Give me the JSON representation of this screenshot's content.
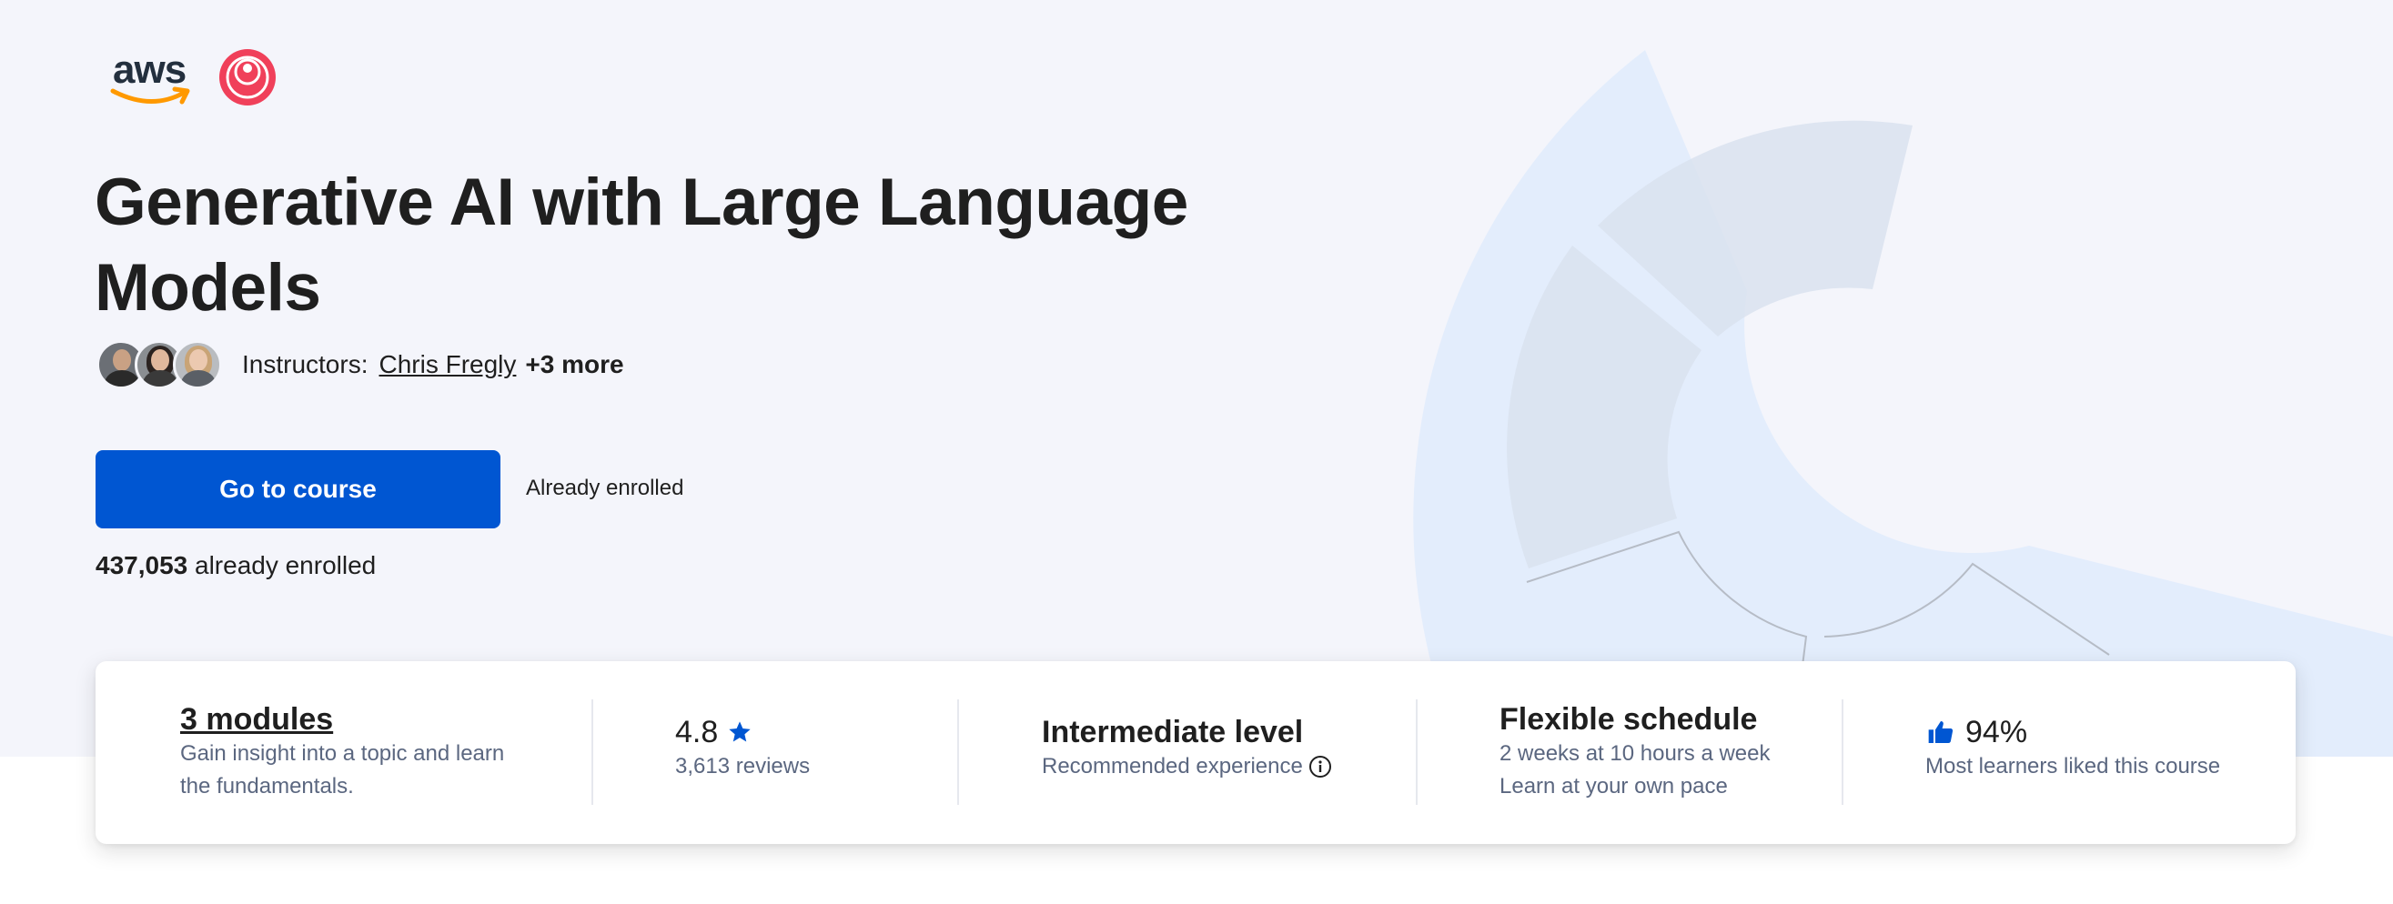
{
  "logos": {
    "aws_text": "aws",
    "aws_icon": "aws-logo",
    "partner_icon": "deeplearning-ai-logo"
  },
  "course": {
    "title": "Generative AI with Large Language Models"
  },
  "instructors": {
    "label": "Instructors:",
    "primary_name": "Chris Fregly",
    "more": "+3 more"
  },
  "cta": {
    "button_label": "Go to course",
    "status_note": "Already enrolled"
  },
  "enrollment": {
    "count": "437,053",
    "suffix": " already enrolled"
  },
  "stats": {
    "modules": {
      "title": "3 modules",
      "line1": "Gain insight into a topic and learn",
      "line2": "the fundamentals."
    },
    "rating": {
      "value": "4.8",
      "reviews": "3,613 reviews"
    },
    "level": {
      "title": "Intermediate level",
      "sub": "Recommended experience"
    },
    "schedule": {
      "title": "Flexible schedule",
      "line1": "2 weeks at 10 hours a week",
      "line2": "Learn at your own pace"
    },
    "liked": {
      "value": "94%",
      "sub": "Most learners liked this course"
    }
  },
  "colors": {
    "accent": "#0056d2",
    "hero_bg": "#f4f5fb",
    "text": "#1f1f1f",
    "muted": "#5b6780"
  }
}
